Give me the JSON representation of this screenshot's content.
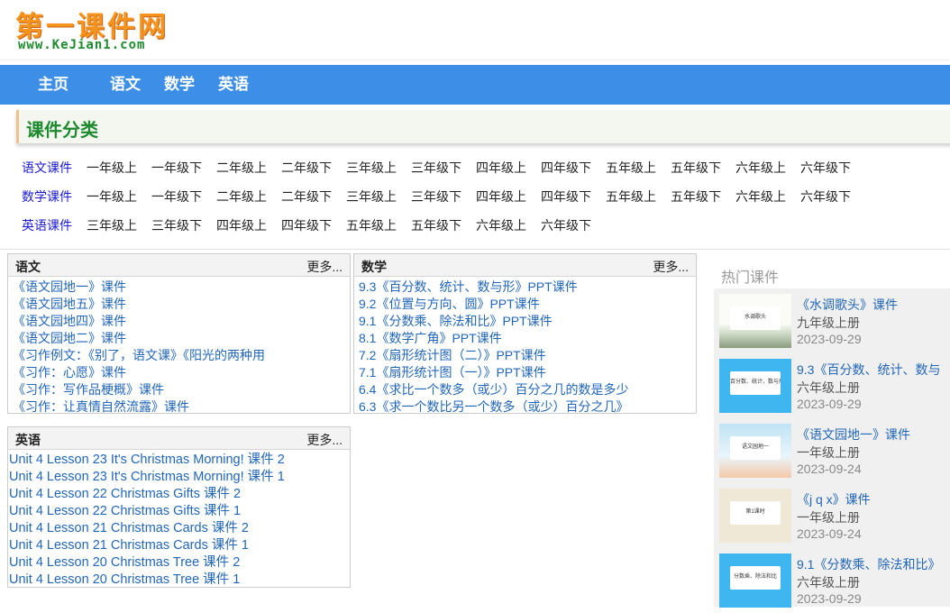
{
  "logo": {
    "title": "第一课件网",
    "url": "www.KeJian1.com"
  },
  "nav": [
    "主页",
    "语文",
    "数学",
    "英语"
  ],
  "category_title": "课件分类",
  "grade_rows": [
    {
      "subject": "语文课件",
      "grades": [
        "一年级上",
        "一年级下",
        "二年级上",
        "二年级下",
        "三年级上",
        "三年级下",
        "四年级上",
        "四年级下",
        "五年级上",
        "五年级下",
        "六年级上",
        "六年级下"
      ]
    },
    {
      "subject": "数学课件",
      "grades": [
        "一年级上",
        "一年级下",
        "二年级上",
        "二年级下",
        "三年级上",
        "三年级下",
        "四年级上",
        "四年级下",
        "五年级上",
        "五年级下",
        "六年级上",
        "六年级下"
      ]
    },
    {
      "subject": "英语课件",
      "grades": [
        "三年级上",
        "三年级下",
        "四年级上",
        "四年级下",
        "五年级上",
        "五年级下",
        "六年级上",
        "六年级下"
      ]
    }
  ],
  "panels": {
    "yuwen": {
      "title": "语文",
      "more": "更多...",
      "items": [
        "《语文园地一》课件",
        "《语文园地五》课件",
        "《语文园地四》课件",
        "《语文园地二》课件",
        "《习作例文：《别了，语文课》《阳光的两种用",
        "《习作：心愿》课件",
        "《习作：写作品梗概》课件",
        "《习作：让真情自然流露》课件"
      ]
    },
    "shuxue": {
      "title": "数学",
      "more": "更多...",
      "items": [
        "9.3《百分数、统计、数与形》PPT课件",
        "9.2《位置与方向、圆》PPT课件",
        "9.1《分数乘、除法和比》PPT课件",
        "8.1《数学广角》PPT课件",
        "7.2《扇形统计图（二）》PPT课件",
        "7.1《扇形统计图（一）》PPT课件",
        "6.4《求比一个数多（或少）百分之几的数是多少",
        "6.3《求一个数比另一个数多（或少）百分之几》"
      ]
    },
    "yingyu": {
      "title": "英语",
      "more": "更多...",
      "items": [
        "Unit 4 Lesson 23 It's Christmas Morning! 课件 2",
        "Unit 4 Lesson 23 It's Christmas Morning! 课件 1",
        "Unit 4 Lesson 22 Christmas Gifts 课件 2",
        "Unit 4 Lesson 22 Christmas Gifts 课件 1",
        "Unit 4 Lesson 21 Christmas Cards 课件 2",
        "Unit 4 Lesson 21 Christmas Cards 课件 1",
        "Unit 4 Lesson 20 Christmas Tree 课件 2",
        "Unit 4 Lesson 20 Christmas Tree 课件 1"
      ]
    }
  },
  "hot": {
    "title": "热门课件",
    "items": [
      {
        "title": "《水调歌头》课件",
        "grade": "九年级上册",
        "date": "2023-09-29",
        "thumb_text": "水调歌头"
      },
      {
        "title": "9.3《百分数、统计、数与",
        "grade": "六年级上册",
        "date": "2023-09-29",
        "thumb_text": "百分数、统计、数与形"
      },
      {
        "title": "《语文园地一》课件",
        "grade": "一年级上册",
        "date": "2023-09-24",
        "thumb_text": "语文园地一"
      },
      {
        "title": "《j q x》课件",
        "grade": "一年级上册",
        "date": "2023-09-24",
        "thumb_text": "第1课时"
      },
      {
        "title": "9.1《分数乘、除法和比》",
        "grade": "六年级上册",
        "date": "2023-09-29",
        "thumb_text": "分数乘、除法和比"
      }
    ]
  },
  "colors": {
    "nav": "#3c8ee6",
    "logo": "#f7941d",
    "category": "#1d8a2e",
    "link": "#2266b8",
    "subject": "#1a1ad6"
  }
}
